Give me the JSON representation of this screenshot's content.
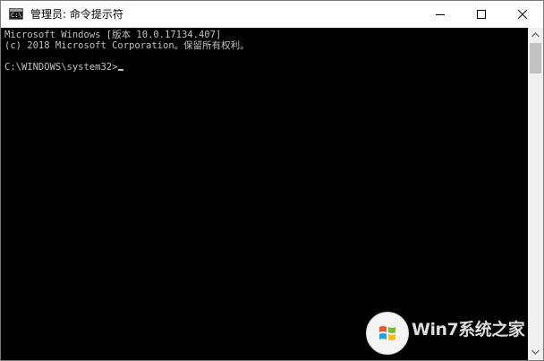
{
  "window": {
    "title": "管理员: 命令提示符",
    "icon_glyph": "C:\\",
    "icon": "cmd-icon",
    "controls": {
      "minimize": "minimize-icon",
      "maximize": "maximize-icon",
      "close": "close-icon"
    }
  },
  "console": {
    "lines": [
      "Microsoft Windows [版本 10.0.17134.407]",
      "(c) 2018 Microsoft Corporation。保留所有权利。",
      "C:\\WINDOWS\\system32>"
    ],
    "text_color": "#c0c0c0",
    "background_color": "#000000"
  },
  "scrollbar": {
    "up_icon": "scroll-up-arrow-icon",
    "down_icon": "scroll-down-arrow-icon"
  },
  "watermark": {
    "text": "Win7系统之家",
    "logo": "windows-flag-logo"
  }
}
